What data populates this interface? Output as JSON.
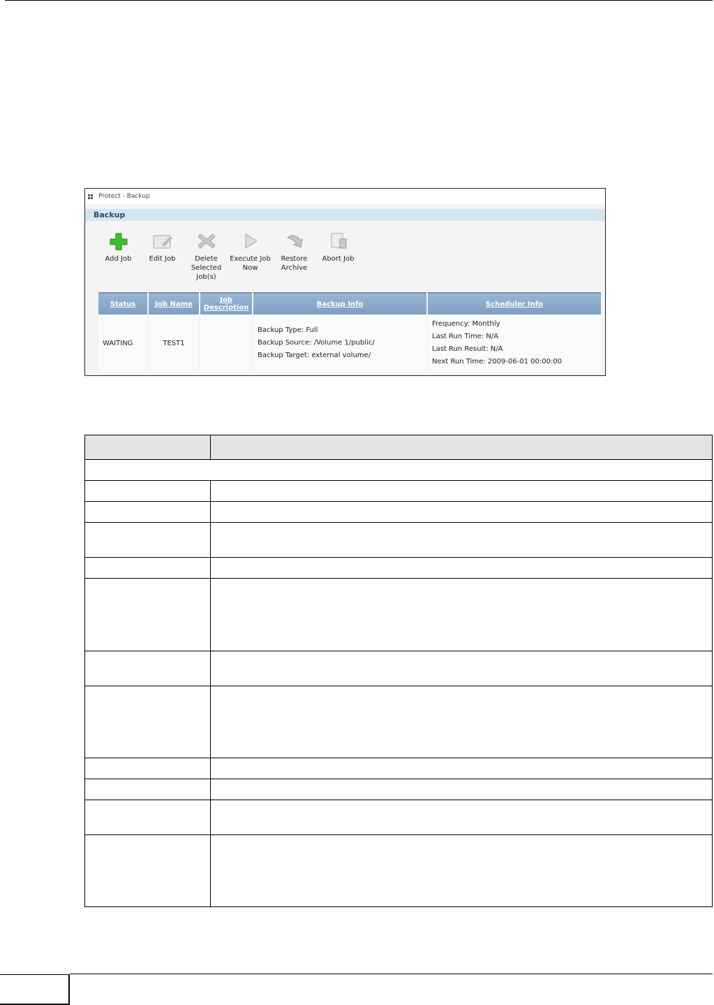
{
  "window": {
    "title": "Protect - Backup",
    "section": "Backup"
  },
  "toolbar": [
    {
      "label": "Add Job",
      "icon": "add-icon"
    },
    {
      "label": "Edit Job",
      "icon": "edit-icon"
    },
    {
      "label": "Delete Selected Job(s)",
      "icon": "delete-icon"
    },
    {
      "label": "Execute Job Now",
      "icon": "play-icon"
    },
    {
      "label": "Restore Archive",
      "icon": "restore-icon"
    },
    {
      "label": "Abort Job",
      "icon": "abort-icon"
    }
  ],
  "table": {
    "headers": [
      "Status",
      "Job Name",
      "Job Description",
      "Backup Info",
      "Scheduler Info"
    ],
    "row": {
      "status": "WAITING",
      "name": "TEST1",
      "description": "",
      "backup_info": [
        "Backup Type: Full",
        "Backup Source: /Volume 1/public/",
        "Backup Target: external volume/"
      ],
      "scheduler_info": [
        "Frequency: Monthly",
        "Last Run Time: N/A",
        "Last Run Result: N/A",
        "Next Run Time: 2009-06-01 00:00:00"
      ]
    }
  }
}
